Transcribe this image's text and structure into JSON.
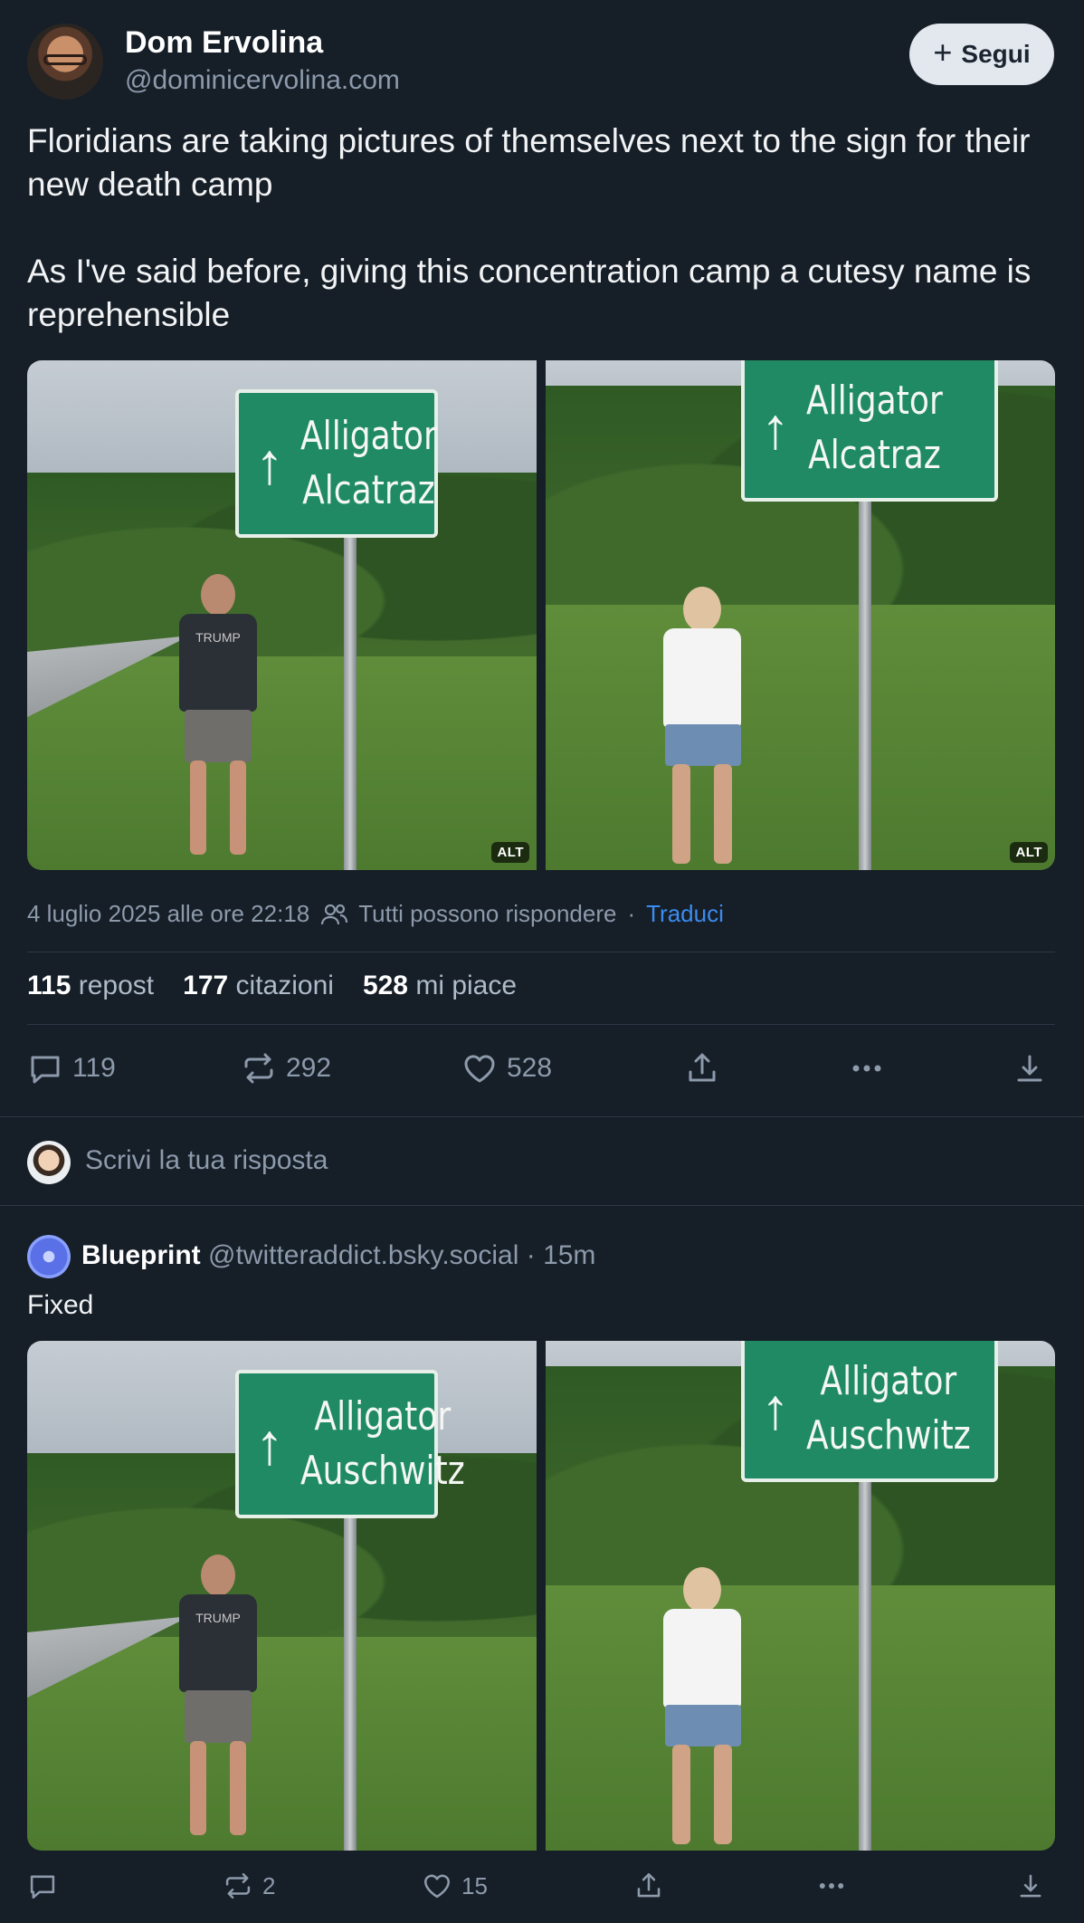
{
  "post": {
    "author_name": "Dom Ervolina",
    "author_handle": "@dominicervolina.com",
    "follow_label": "Segui",
    "paragraph1": "Floridians are taking pictures of themselves next to the sign for their new death camp",
    "paragraph2": "As I've said before, giving this concentration camp a cutesy name is reprehensible",
    "images": [
      {
        "sign_line1": "Alligator",
        "sign_line2": "Alcatraz",
        "alt_badge": "ALT",
        "shirt_text": "TRUMP"
      },
      {
        "sign_line1": "Alligator",
        "sign_line2": "Alcatraz",
        "alt_badge": "ALT"
      }
    ],
    "timestamp": "4 luglio 2025 alle ore 22:18",
    "reply_setting": "Tutti possono rispondere",
    "separator": "·",
    "translate_label": "Traduci",
    "stats": {
      "reposts_count": "115",
      "reposts_label": "repost",
      "quotes_count": "177",
      "quotes_label": "citazioni",
      "likes_count": "528",
      "likes_label": "mi piace"
    },
    "actions": {
      "replies": "119",
      "reposts": "292",
      "likes": "528"
    }
  },
  "composer": {
    "placeholder": "Scrivi la tua risposta"
  },
  "reply": {
    "author_name": "Blueprint",
    "author_handle": "@twitteraddict.bsky.social",
    "separator": "·",
    "time": "15m",
    "text": "Fixed",
    "images": [
      {
        "sign_line1": "Alligator",
        "sign_line2": "Auschwitz",
        "shirt_text": "TRUMP"
      },
      {
        "sign_line1": "Alligator",
        "sign_line2": "Auschwitz"
      }
    ],
    "actions": {
      "replies": "",
      "reposts": "2",
      "likes": "15"
    }
  },
  "colors": {
    "background": "#161e27",
    "accent_link": "#3b8cf0",
    "sign_green": "#1f8a63"
  },
  "icons": [
    "plus-icon",
    "people-icon",
    "comment-icon",
    "repost-icon",
    "heart-icon",
    "share-icon",
    "more-icon",
    "download-icon"
  ]
}
